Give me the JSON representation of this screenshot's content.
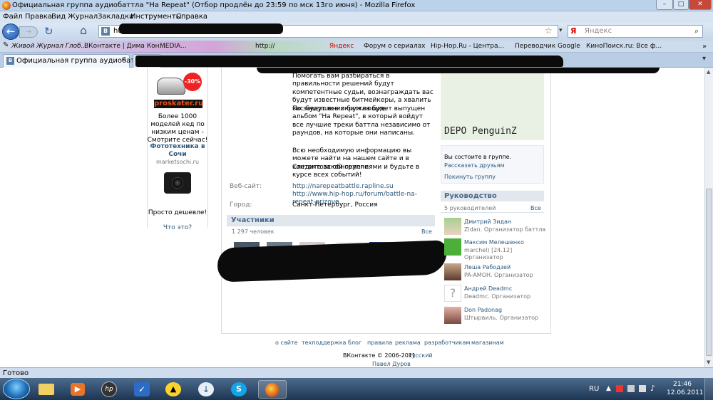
{
  "window": {
    "title": "Официальная группа аудиобаттла \"На Repeat\" (Отбор продлён до 23:59 по мск 13го июня) - Mozilla Firefox",
    "min": "–",
    "max": "□",
    "close": "✕"
  },
  "menu": [
    "Файл",
    "Правка",
    "Вид",
    "Журнал",
    "Закладки",
    "Инструменты",
    "Справка"
  ],
  "nav": {
    "url": "http://",
    "search_placeholder": "Яндекс"
  },
  "bookmarks": [
    "Живой Журнал Глоб...",
    "ВКонтакте | Дима Кон...",
    "MEDIA...",
    "http://",
    "Яндекс",
    "Форум о сериалах",
    "Hip-Hop.Ru - Центра...",
    "Переводчик Google",
    "КиноПоиск.ru: Все ф..."
  ],
  "tab": {
    "label": "Официальная группа аудиобаттл..."
  },
  "left_ads": {
    "ad1_discount": "-30%",
    "ad1_brand": "proskater.ru",
    "ad1_text": "Более 1000 моделей кед по низким ценам - Смотрите сейчас!",
    "ad2_title": "Фототехника в Сочи",
    "ad2_domain": "marketsochi.ru",
    "ad2_text": "Просто дешевле!",
    "what_is": "Что это?"
  },
  "description": {
    "p1": "Помогать вам разбираться в правильности решений будут компетентные судьи, вознаграждать вас будут известные битмейкеры, а хвалить вас будут все окружающие.",
    "p2": "По завершении баттла будет выпущен альбом \"На Repeat\", в который войдут все лучшие треки баттла независимо от раундов, на которые они написаны.",
    "p3": "Всю необходимую информацию вы можете найти на нашем сайте и в контактовской группе.",
    "p4": "Следите за обновлениями и будьте в курсе всех событий!",
    "website_label": "Веб-сайт:",
    "website_value": "http://narepeatbattle.rapline.su http://www.hip-hop.ru/forum/battle-na-repeat-prizovo...",
    "city_label": "Город:",
    "city_value": "Санкт-Петербург, Россия"
  },
  "members": {
    "title": "Участники",
    "count": "1 297 человек",
    "all": "Все"
  },
  "right": {
    "poster_text": "DEPO PenguinZ",
    "in_group": "Вы состоите в группе.",
    "tell_friends": "Рассказать друзьям",
    "leave": "Покинуть группу",
    "leadership_title": "Руководство",
    "leaders_count": "5 руководителей",
    "leaders_all": "Все",
    "leaders": [
      {
        "name": "Дмитрий Зидан",
        "role": "Zidan. Организатор баттла",
        "role2": ""
      },
      {
        "name": "Максим Мелешенко",
        "role": "marchel) [24.12]",
        "role2": "Организатор"
      },
      {
        "name": "Леша Рабодзей",
        "role": "PA-AMOH. Организатор",
        "role2": ""
      },
      {
        "name": "Андрей Deadmc",
        "role": "Deadmc. Организатор",
        "role2": ""
      },
      {
        "name": "Don Padonag",
        "role": "Штырвиль. Организатор",
        "role2": ""
      }
    ]
  },
  "footer": {
    "links": [
      "о сайте",
      "техподдержка",
      "блог",
      "правила",
      "реклама",
      "разработчикам",
      "магазинам"
    ],
    "copyright": "ВКонтакте © 2006-2011",
    "lang": "Русский",
    "author": "Павел Дуров"
  },
  "status": "Готово",
  "taskbar": {
    "lang": "RU",
    "time": "21:46",
    "date": "12.06.2011"
  }
}
